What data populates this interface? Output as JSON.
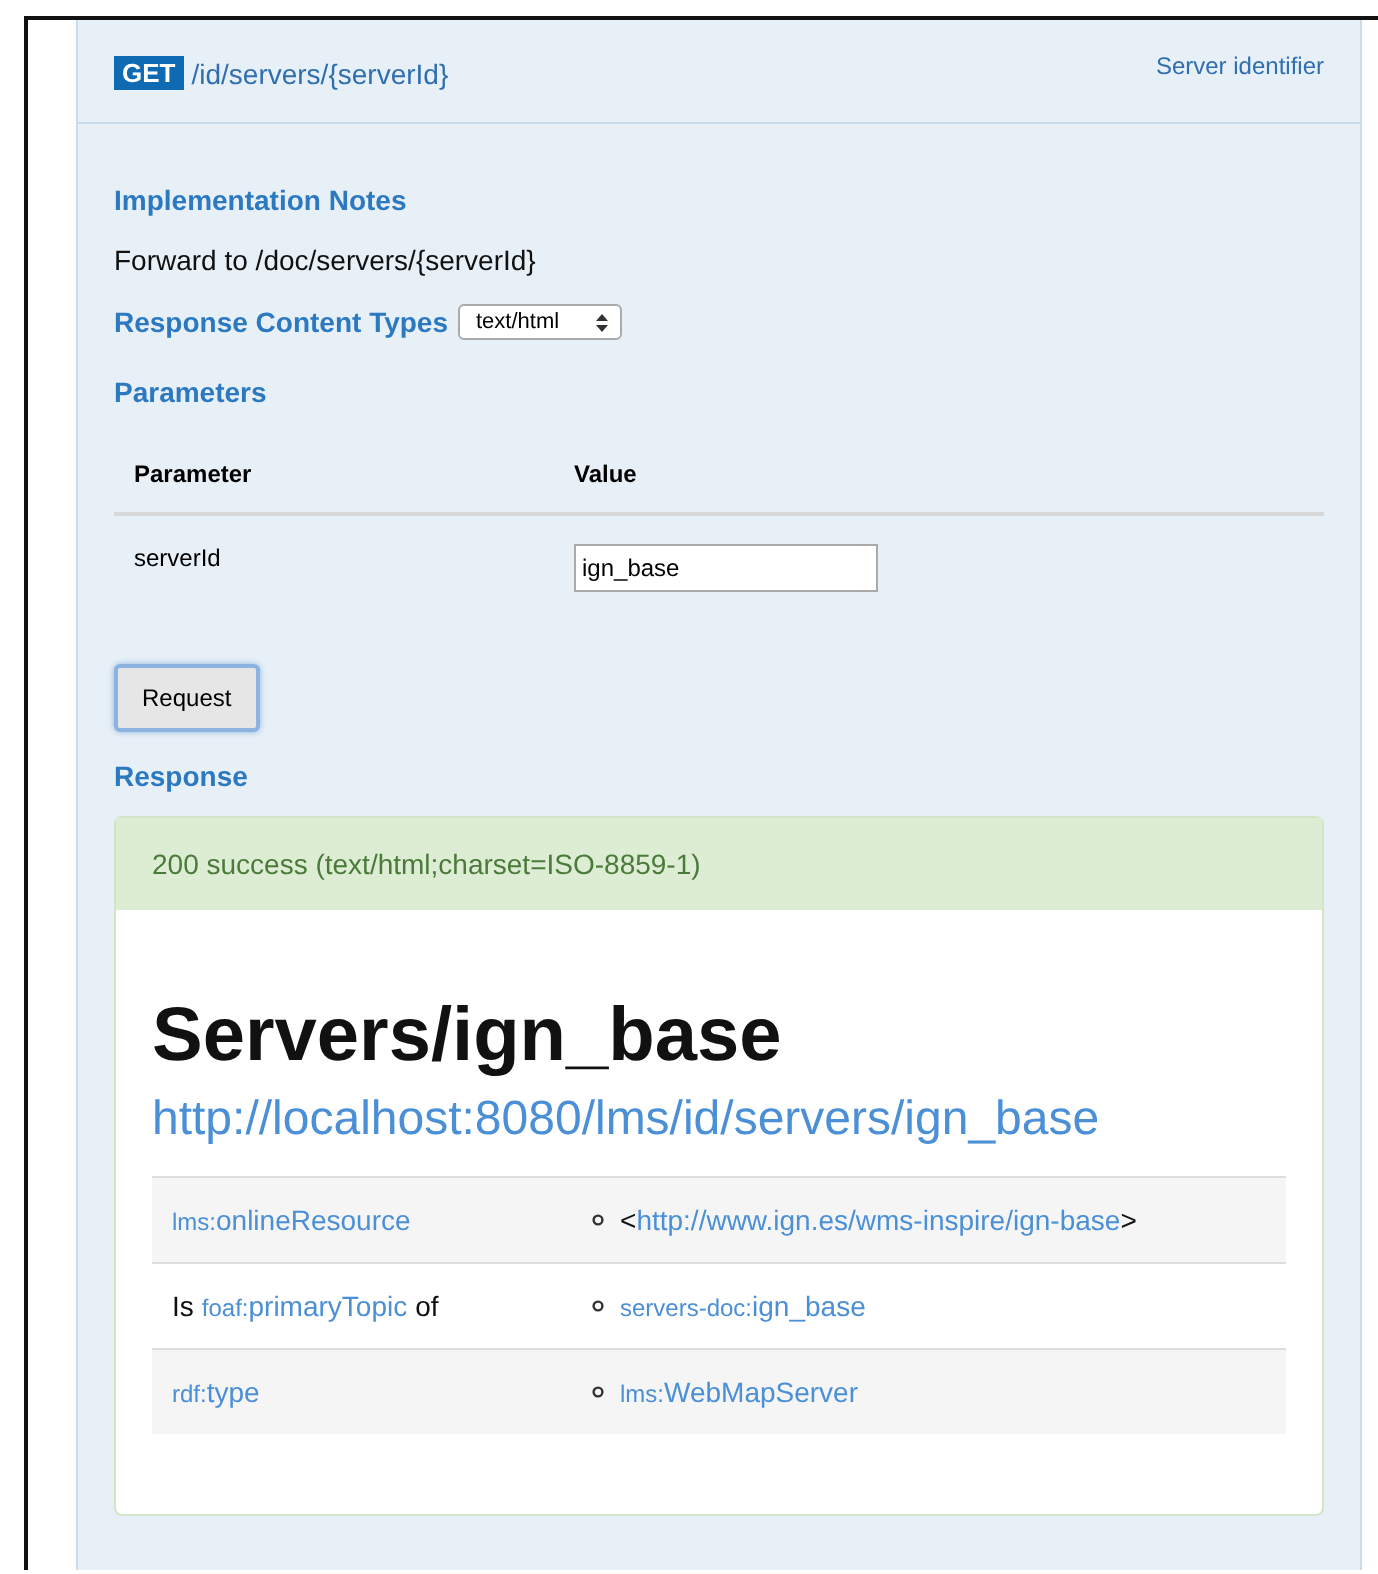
{
  "endpoint": {
    "method": "GET",
    "path": "/id/servers/{serverId}",
    "summary": "Server identifier"
  },
  "implementation_notes": {
    "heading": "Implementation Notes",
    "text": "Forward to /doc/servers/{serverId}"
  },
  "content_types": {
    "label": "Response Content Types",
    "value": "text/html"
  },
  "parameters": {
    "heading": "Parameters",
    "columns": [
      "Parameter",
      "Value"
    ],
    "rows": [
      {
        "name": "serverId",
        "value": "ign_base"
      }
    ]
  },
  "request_button": "Request",
  "response": {
    "heading": "Response",
    "status": "200 success (text/html;charset=ISO-8859-1)",
    "title": "Servers/ign_base",
    "url": "http://localhost:8080/lms/id/servers/ign_base",
    "rows": [
      {
        "predicate": {
          "prefix": "lms:",
          "local": "onlineResource"
        },
        "object": {
          "before": "<",
          "local": "http://www.ign.es/wms-inspire/ign-base",
          "after": ">"
        }
      },
      {
        "predicate": {
          "before": "Is",
          "prefix": "foaf:",
          "local": "primaryTopic",
          "after": "of"
        },
        "object": {
          "prefix": "servers-doc:",
          "local": "ign_base"
        }
      },
      {
        "predicate": {
          "prefix": "rdf:",
          "local": "type"
        },
        "object": {
          "prefix": "lms:",
          "local": "WebMapServer"
        }
      }
    ]
  }
}
